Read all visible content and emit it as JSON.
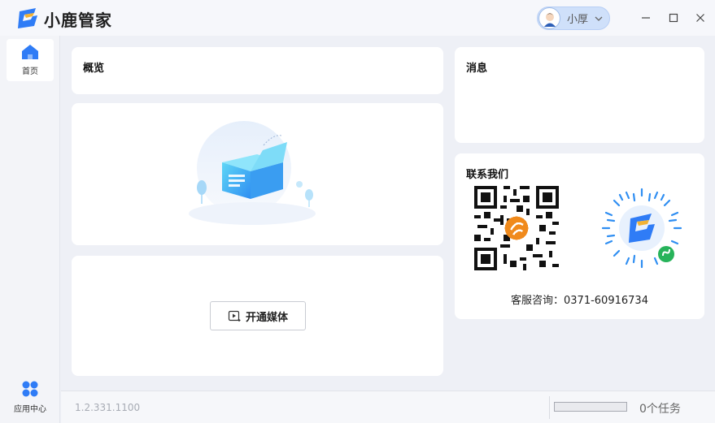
{
  "app": {
    "title": "小鹿管家",
    "brand_color": "#2f7cf6"
  },
  "user": {
    "name": "小厚"
  },
  "window_controls": [
    "minimize-icon",
    "maximize-icon",
    "close-icon"
  ],
  "sidebar": {
    "items": [
      {
        "label": "首页",
        "icon": "home-icon",
        "active": true
      },
      {
        "label": "应用中心",
        "icon": "apps-icon",
        "active": false
      }
    ]
  },
  "overview": {
    "title": "概览"
  },
  "media": {
    "open_label": "开通媒体"
  },
  "messages": {
    "title": "消息"
  },
  "contact": {
    "title": "联系我们",
    "hotline": "客服咨询：0371-60916734"
  },
  "footer": {
    "version": "1.2.331.1100",
    "progress": 0,
    "tasks": "0个任务"
  }
}
